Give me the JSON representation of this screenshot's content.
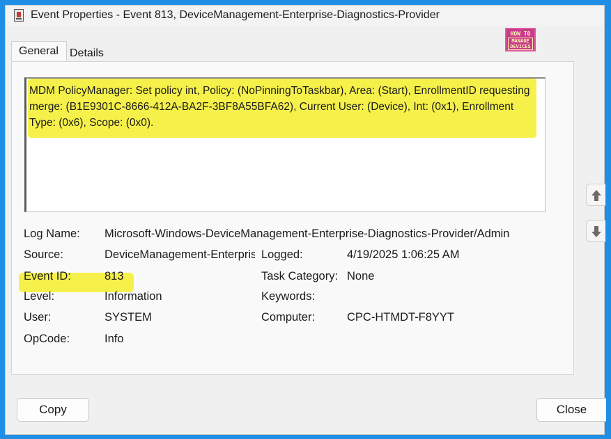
{
  "window": {
    "title": "Event Properties - Event 813, DeviceManagement-Enterprise-Diagnostics-Provider"
  },
  "tabs": [
    {
      "label": "General",
      "active": true
    },
    {
      "label": "Details",
      "active": false
    }
  ],
  "logo": {
    "line1": "HOW TO",
    "line2": "MANAGE",
    "line3": "DEVICES"
  },
  "description": {
    "text": "MDM PolicyManager: Set policy int, Policy: (NoPinningToTaskbar), Area: (Start), EnrollmentID requesting merge: (B1E9301C-8666-412A-BA2F-3BF8A55BFA62), Current User: (Device), Int: (0x1), Enrollment Type: (0x6), Scope: (0x0)."
  },
  "fields": {
    "log_name": {
      "label": "Log Name:",
      "value": "Microsoft-Windows-DeviceManagement-Enterprise-Diagnostics-Provider/Admin"
    },
    "source": {
      "label": "Source:",
      "value": "DeviceManagement-Enterprise-Diagnostics-Provider"
    },
    "logged": {
      "label": "Logged:",
      "value": "4/19/2025 1:06:25 AM"
    },
    "event_id": {
      "label": "Event ID:",
      "value": "813"
    },
    "task_category": {
      "label": "Task Category:",
      "value": "None"
    },
    "level": {
      "label": "Level:",
      "value": "Information"
    },
    "keywords": {
      "label": "Keywords:",
      "value": ""
    },
    "user": {
      "label": "User:",
      "value": "SYSTEM"
    },
    "computer": {
      "label": "Computer:",
      "value": "CPC-HTMDT-F8YYT"
    },
    "opcode": {
      "label": "OpCode:",
      "value": "Info"
    }
  },
  "buttons": {
    "copy": "Copy",
    "close": "Close"
  },
  "icons": {
    "up": "arrow-up-icon",
    "down": "arrow-down-icon",
    "app": "event-properties-icon"
  },
  "colors": {
    "highlight": "#f6f14a",
    "frame": "#1f8fe6",
    "logo": "#c93a8a"
  }
}
